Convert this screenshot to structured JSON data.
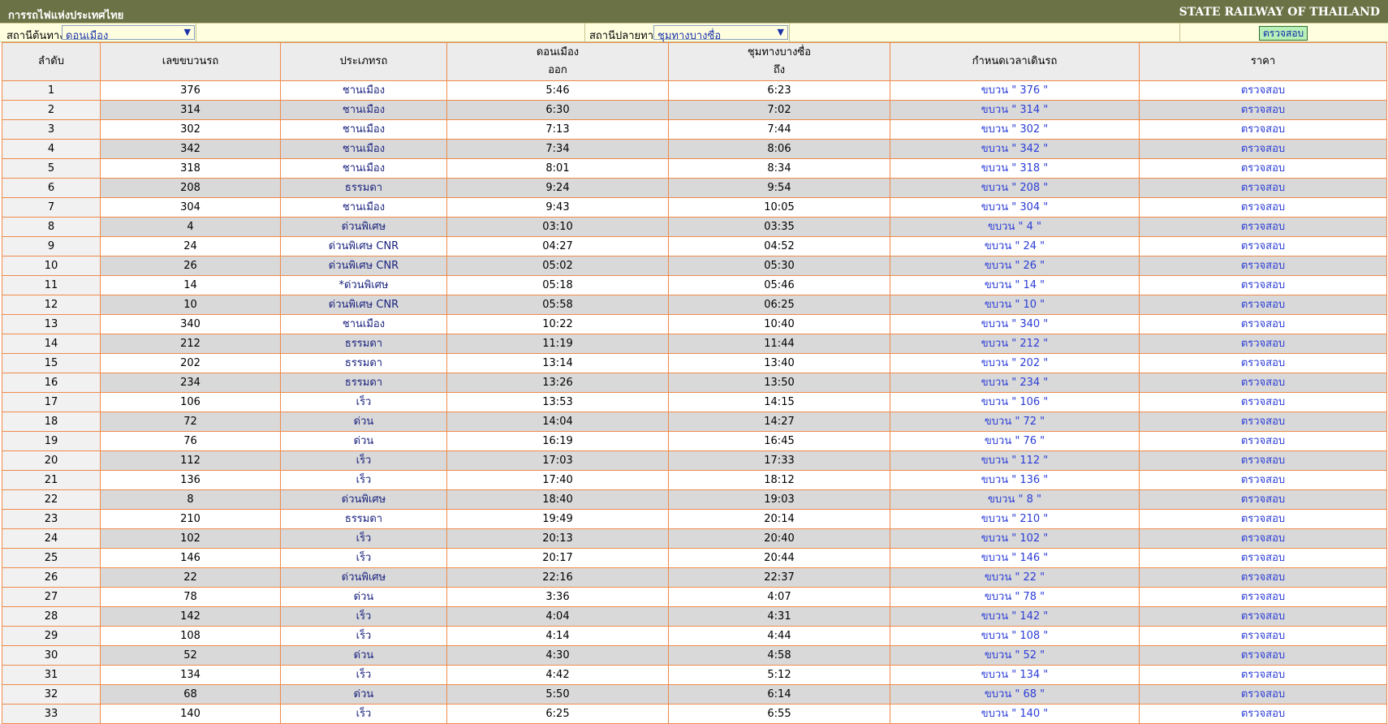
{
  "header": {
    "left_title": "การรถไฟแห่งประเทศไทย",
    "right_title": "STATE RAILWAY OF THAILAND"
  },
  "search": {
    "origin_label": "สถานีต้นทาง",
    "origin_value": "ดอนเมือง",
    "destination_label": "สถานีปลายทาง",
    "destination_value": "ชุมทางบางซื่อ",
    "check_button": "ตรวจสอบ"
  },
  "table": {
    "headers": {
      "seq": "ลำดับ",
      "train_no": "เลขขบวนรถ",
      "type": "ประเภทรถ",
      "depart_station": "ดอนเมือง",
      "depart_label": "ออก",
      "arrive_station": "ชุมทางบางซื่อ",
      "arrive_label": "ถึง",
      "schedule": "กำหนดเวลาเดินรถ",
      "price": "ราคา"
    },
    "rows": [
      {
        "seq": "1",
        "train": "376",
        "type": "ชานเมือง",
        "dep": "5:46",
        "arr": "6:23",
        "sched": "ขบวน \" 376 \"",
        "price": "ตรวจสอบ"
      },
      {
        "seq": "2",
        "train": "314",
        "type": "ชานเมือง",
        "dep": "6:30",
        "arr": "7:02",
        "sched": "ขบวน \" 314 \"",
        "price": "ตรวจสอบ"
      },
      {
        "seq": "3",
        "train": "302",
        "type": "ชานเมือง",
        "dep": "7:13",
        "arr": "7:44",
        "sched": "ขบวน \" 302 \"",
        "price": "ตรวจสอบ"
      },
      {
        "seq": "4",
        "train": "342",
        "type": "ชานเมือง",
        "dep": "7:34",
        "arr": "8:06",
        "sched": "ขบวน \" 342 \"",
        "price": "ตรวจสอบ"
      },
      {
        "seq": "5",
        "train": "318",
        "type": "ชานเมือง",
        "dep": "8:01",
        "arr": "8:34",
        "sched": "ขบวน \" 318 \"",
        "price": "ตรวจสอบ"
      },
      {
        "seq": "6",
        "train": "208",
        "type": "ธรรมดา",
        "dep": "9:24",
        "arr": "9:54",
        "sched": "ขบวน \" 208 \"",
        "price": "ตรวจสอบ"
      },
      {
        "seq": "7",
        "train": "304",
        "type": "ชานเมือง",
        "dep": "9:43",
        "arr": "10:05",
        "sched": "ขบวน \" 304 \"",
        "price": "ตรวจสอบ"
      },
      {
        "seq": "8",
        "train": "4",
        "type": "ด่วนพิเศษ",
        "dep": "03:10",
        "arr": "03:35",
        "sched": "ขบวน \" 4 \"",
        "price": "ตรวจสอบ"
      },
      {
        "seq": "9",
        "train": "24",
        "type": "ด่วนพิเศษ CNR",
        "dep": "04:27",
        "arr": "04:52",
        "sched": "ขบวน \" 24 \"",
        "price": "ตรวจสอบ"
      },
      {
        "seq": "10",
        "train": "26",
        "type": "ด่วนพิเศษ CNR",
        "dep": "05:02",
        "arr": "05:30",
        "sched": "ขบวน \" 26 \"",
        "price": "ตรวจสอบ"
      },
      {
        "seq": "11",
        "train": "14",
        "type": "*ด่วนพิเศษ",
        "dep": "05:18",
        "arr": "05:46",
        "sched": "ขบวน \" 14 \"",
        "price": "ตรวจสอบ"
      },
      {
        "seq": "12",
        "train": "10",
        "type": "ด่วนพิเศษ CNR",
        "dep": "05:58",
        "arr": "06:25",
        "sched": "ขบวน \" 10 \"",
        "price": "ตรวจสอบ"
      },
      {
        "seq": "13",
        "train": "340",
        "type": "ชานเมือง",
        "dep": "10:22",
        "arr": "10:40",
        "sched": "ขบวน \" 340 \"",
        "price": "ตรวจสอบ"
      },
      {
        "seq": "14",
        "train": "212",
        "type": "ธรรมดา",
        "dep": "11:19",
        "arr": "11:44",
        "sched": "ขบวน \" 212 \"",
        "price": "ตรวจสอบ"
      },
      {
        "seq": "15",
        "train": "202",
        "type": "ธรรมดา",
        "dep": "13:14",
        "arr": "13:40",
        "sched": "ขบวน \" 202 \"",
        "price": "ตรวจสอบ"
      },
      {
        "seq": "16",
        "train": "234",
        "type": "ธรรมดา",
        "dep": "13:26",
        "arr": "13:50",
        "sched": "ขบวน \" 234 \"",
        "price": "ตรวจสอบ"
      },
      {
        "seq": "17",
        "train": "106",
        "type": "เร็ว",
        "dep": "13:53",
        "arr": "14:15",
        "sched": "ขบวน \" 106 \"",
        "price": "ตรวจสอบ"
      },
      {
        "seq": "18",
        "train": "72",
        "type": "ด่วน",
        "dep": "14:04",
        "arr": "14:27",
        "sched": "ขบวน \" 72 \"",
        "price": "ตรวจสอบ"
      },
      {
        "seq": "19",
        "train": "76",
        "type": "ด่วน",
        "dep": "16:19",
        "arr": "16:45",
        "sched": "ขบวน \" 76 \"",
        "price": "ตรวจสอบ"
      },
      {
        "seq": "20",
        "train": "112",
        "type": "เร็ว",
        "dep": "17:03",
        "arr": "17:33",
        "sched": "ขบวน \" 112 \"",
        "price": "ตรวจสอบ"
      },
      {
        "seq": "21",
        "train": "136",
        "type": "เร็ว",
        "dep": "17:40",
        "arr": "18:12",
        "sched": "ขบวน \" 136 \"",
        "price": "ตรวจสอบ"
      },
      {
        "seq": "22",
        "train": "8",
        "type": "ด่วนพิเศษ",
        "dep": "18:40",
        "arr": "19:03",
        "sched": "ขบวน \" 8 \"",
        "price": "ตรวจสอบ"
      },
      {
        "seq": "23",
        "train": "210",
        "type": "ธรรมดา",
        "dep": "19:49",
        "arr": "20:14",
        "sched": "ขบวน \" 210 \"",
        "price": "ตรวจสอบ"
      },
      {
        "seq": "24",
        "train": "102",
        "type": "เร็ว",
        "dep": "20:13",
        "arr": "20:40",
        "sched": "ขบวน \" 102 \"",
        "price": "ตรวจสอบ"
      },
      {
        "seq": "25",
        "train": "146",
        "type": "เร็ว",
        "dep": "20:17",
        "arr": "20:44",
        "sched": "ขบวน \" 146 \"",
        "price": "ตรวจสอบ"
      },
      {
        "seq": "26",
        "train": "22",
        "type": "ด่วนพิเศษ",
        "dep": "22:16",
        "arr": "22:37",
        "sched": "ขบวน \" 22 \"",
        "price": "ตรวจสอบ"
      },
      {
        "seq": "27",
        "train": "78",
        "type": "ด่วน",
        "dep": "3:36",
        "arr": "4:07",
        "sched": "ขบวน \" 78 \"",
        "price": "ตรวจสอบ"
      },
      {
        "seq": "28",
        "train": "142",
        "type": "เร็ว",
        "dep": "4:04",
        "arr": "4:31",
        "sched": "ขบวน \" 142 \"",
        "price": "ตรวจสอบ"
      },
      {
        "seq": "29",
        "train": "108",
        "type": "เร็ว",
        "dep": "4:14",
        "arr": "4:44",
        "sched": "ขบวน \" 108 \"",
        "price": "ตรวจสอบ"
      },
      {
        "seq": "30",
        "train": "52",
        "type": "ด่วน",
        "dep": "4:30",
        "arr": "4:58",
        "sched": "ขบวน \" 52 \"",
        "price": "ตรวจสอบ"
      },
      {
        "seq": "31",
        "train": "134",
        "type": "เร็ว",
        "dep": "4:42",
        "arr": "5:12",
        "sched": "ขบวน \" 134 \"",
        "price": "ตรวจสอบ"
      },
      {
        "seq": "32",
        "train": "68",
        "type": "ด่วน",
        "dep": "5:50",
        "arr": "6:14",
        "sched": "ขบวน \" 68 \"",
        "price": "ตรวจสอบ"
      },
      {
        "seq": "33",
        "train": "140",
        "type": "เร็ว",
        "dep": "6:25",
        "arr": "6:55",
        "sched": "ขบวน \" 140 \"",
        "price": "ตรวจสอบ"
      }
    ]
  }
}
